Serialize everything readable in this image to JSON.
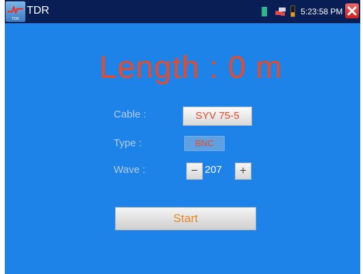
{
  "titlebar": {
    "app_name": "TDR",
    "app_icon_label": "TDR",
    "clock": "5:23:58 PM"
  },
  "main": {
    "length_readout": "Length : 0 m",
    "cable": {
      "label": "Cable  :",
      "value": "SYV 75-5"
    },
    "type": {
      "label": "Type   :",
      "value": "BNC"
    },
    "wave": {
      "label": "Wave   :",
      "value": "207",
      "decrement": "−",
      "increment": "+"
    },
    "start_label": "Start"
  },
  "colors": {
    "background": "#1d83e8",
    "titlebar": "#0a1e56",
    "accent_text": "#e84a28",
    "start_text": "#e88820"
  }
}
